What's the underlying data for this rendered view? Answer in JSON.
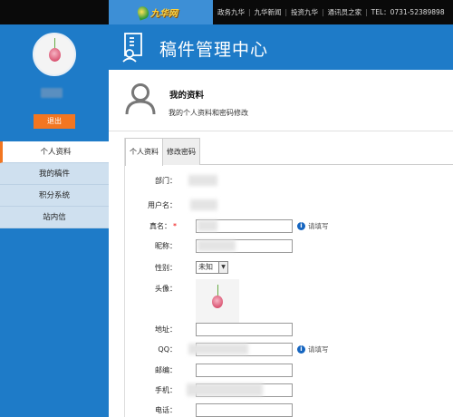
{
  "site": {
    "logo_text": "九华网",
    "nav": [
      "政务九华",
      "九华新闻",
      "投资九华",
      "通讯员之家",
      "TEL：0731-52389898"
    ]
  },
  "header": {
    "title": "稿件管理中心"
  },
  "sidebar": {
    "logout_label": "退出",
    "items": [
      {
        "label": "个人资料",
        "active": true
      },
      {
        "label": "我的稿件",
        "active": false
      },
      {
        "label": "积分系统",
        "active": false
      },
      {
        "label": "站内信",
        "active": false
      }
    ]
  },
  "profile": {
    "title": "我的资料",
    "subtitle": "我的个人资料和密码修改"
  },
  "tabs": [
    {
      "label": "个人资料",
      "active": true
    },
    {
      "label": "修改密码",
      "active": false
    }
  ],
  "form": {
    "department_label": "部门：",
    "username_label": "用户名：",
    "realname_label": "真名：",
    "required_mark": "*",
    "realname_hint": "请填写",
    "nickname_label": "昵称：",
    "gender_label": "性别：",
    "gender_value": "未知",
    "avatar_label": "头像：",
    "address_label": "地址：",
    "qq_label": "QQ：",
    "qq_hint": "请填写",
    "postcode_label": "邮编：",
    "mobile_label": "手机：",
    "phone_label": "电话："
  },
  "icons": {
    "person": "user-silhouette-icon",
    "header": "document-user-icon",
    "info": "info-icon",
    "dropdown": "chevron-down-icon"
  },
  "colors": {
    "brand_blue": "#1e7bc8",
    "accent_orange": "#f27621",
    "info_blue": "#1565c0"
  }
}
